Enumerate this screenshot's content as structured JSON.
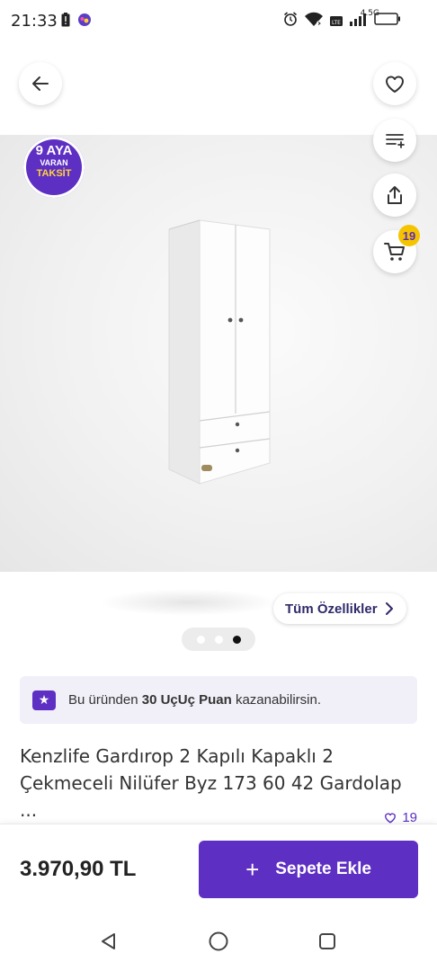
{
  "status_bar": {
    "time": "21:33",
    "network": "4.5G"
  },
  "installment_badge": {
    "line1": "9 AYA",
    "line2": "VARAN",
    "line3": "TAKSİT"
  },
  "cart": {
    "count": "19"
  },
  "features_button": {
    "label": "Tüm Özellikler"
  },
  "carousel": {
    "total": 3,
    "active_index": 2
  },
  "points_banner": {
    "prefix": "Bu üründen ",
    "bold": "30 UçUç Puan",
    "suffix": " kazanabilirsin."
  },
  "product": {
    "title": "Kenzlife Gardırop 2 Kapılı Kapaklı 2 Çekmeceli Nilüfer Byz 173 60 42 Gardolap ...",
    "favorite_count": "19"
  },
  "purchase": {
    "price": "3.970,90 TL",
    "add_to_cart_label": "Sepete Ekle"
  },
  "colors": {
    "brand": "#5d2fc2",
    "badge_yellow": "#f5c400"
  },
  "icons": [
    "back-arrow-icon",
    "heart-icon",
    "compare-list-icon",
    "share-icon",
    "cart-icon",
    "star-icon",
    "chevron-right-icon",
    "plus-icon",
    "nav-back-icon",
    "nav-home-icon",
    "nav-recents-icon"
  ]
}
